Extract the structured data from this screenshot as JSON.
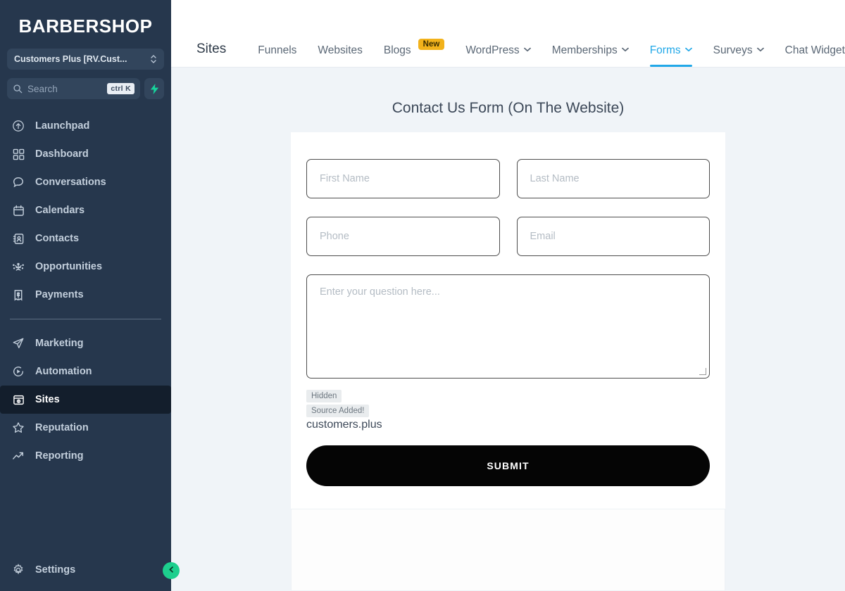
{
  "sidebar": {
    "brand": "BARBERSHOP",
    "location_switcher": {
      "label": "Customers Plus [RV.Cust...",
      "icon": "updown-stepper-icon"
    },
    "search": {
      "placeholder": "Search",
      "shortcut": "ctrl K",
      "icon": "search-icon",
      "spark_icon": "lightning-bolt-icon"
    },
    "items": [
      {
        "label": "Launchpad",
        "icon": "rocket-launch-icon",
        "active": false
      },
      {
        "label": "Dashboard",
        "icon": "grid-dashboard-icon",
        "active": false
      },
      {
        "label": "Conversations",
        "icon": "chat-bubble-icon",
        "active": false
      },
      {
        "label": "Calendars",
        "icon": "calendar-icon",
        "active": false
      },
      {
        "label": "Contacts",
        "icon": "contact-book-icon",
        "active": false
      },
      {
        "label": "Opportunities",
        "icon": "funnel-nodes-icon",
        "active": false
      },
      {
        "label": "Payments",
        "icon": "receipt-dollar-icon",
        "active": false
      }
    ],
    "items2": [
      {
        "label": "Marketing",
        "icon": "paper-plane-icon",
        "active": false
      },
      {
        "label": "Automation",
        "icon": "play-circle-icon",
        "active": false
      },
      {
        "label": "Sites",
        "icon": "browser-window-icon",
        "active": true
      },
      {
        "label": "Reputation",
        "icon": "star-icon",
        "active": false
      },
      {
        "label": "Reporting",
        "icon": "trend-up-icon",
        "active": false
      }
    ],
    "settings": {
      "label": "Settings",
      "icon": "gear-icon"
    },
    "collapse_button": {
      "icon": "chevron-left-icon"
    }
  },
  "topnav": {
    "section": "Sites",
    "items": [
      {
        "label": "Funnels",
        "caret": false,
        "badge": null,
        "active": false
      },
      {
        "label": "Websites",
        "caret": false,
        "badge": null,
        "active": false
      },
      {
        "label": "Blogs",
        "caret": false,
        "badge": "New",
        "active": false
      },
      {
        "label": "WordPress",
        "caret": true,
        "badge": null,
        "active": false
      },
      {
        "label": "Memberships",
        "caret": true,
        "badge": null,
        "active": false
      },
      {
        "label": "Forms",
        "caret": true,
        "badge": null,
        "active": true
      },
      {
        "label": "Surveys",
        "caret": true,
        "badge": null,
        "active": false
      },
      {
        "label": "Chat Widget",
        "caret": false,
        "badge": null,
        "active": false
      }
    ],
    "caret_glyph": "⌄"
  },
  "form": {
    "title": "Contact Us Form (On The Website)",
    "fields": [
      {
        "name": "first_name",
        "placeholder": "First Name"
      },
      {
        "name": "last_name",
        "placeholder": "Last Name"
      },
      {
        "name": "phone",
        "placeholder": "Phone"
      },
      {
        "name": "email",
        "placeholder": "Email"
      }
    ],
    "textarea": {
      "name": "question",
      "placeholder": "Enter your question here..."
    },
    "hidden_field": {
      "chip_hidden": "Hidden",
      "chip_source": "Source Added!",
      "value": "customers.plus"
    },
    "submit_label": "SUBMIT"
  },
  "colors": {
    "sidebar_bg": "#26374d",
    "sidebar_active": "#131e2c",
    "accent_blue": "#21a8e8",
    "accent_green": "#1dcf8e",
    "badge_amber": "#f2b21b",
    "canvas_bg": "#f0f4f8",
    "submit_bg": "#050505"
  }
}
